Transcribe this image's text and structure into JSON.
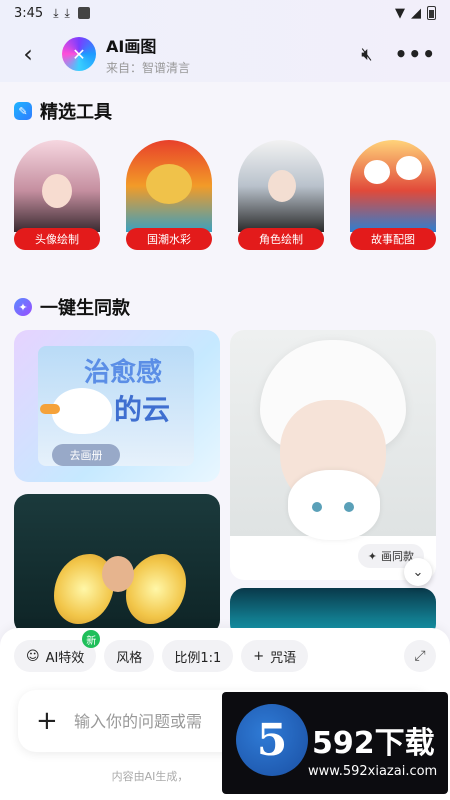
{
  "status_bar": {
    "time": "3:45"
  },
  "header": {
    "title": "AI画图",
    "subtitle": "来自：智谱清言"
  },
  "sections": {
    "tools_title": "精选工具",
    "same_title": "一键生同款"
  },
  "tools": [
    {
      "label": "头像绘制"
    },
    {
      "label": "国潮水彩"
    },
    {
      "label": "角色绘制"
    },
    {
      "label": "故事配图"
    }
  ],
  "cards": {
    "cloud_title_1": "治愈感",
    "cloud_title_2": "的云",
    "cloud_button": "去画册",
    "same_button": "画同款"
  },
  "chips": [
    {
      "label": "AI特效",
      "badge": "新"
    },
    {
      "label": "风格"
    },
    {
      "label": "比例1:1"
    },
    {
      "label": "咒语"
    }
  ],
  "input": {
    "placeholder": "输入你的问题或需"
  },
  "disclaimer": "内容由AI生成，",
  "watermark": {
    "brand": "592下载",
    "logo_digit": "5",
    "url": "www.592xiazai.com"
  }
}
